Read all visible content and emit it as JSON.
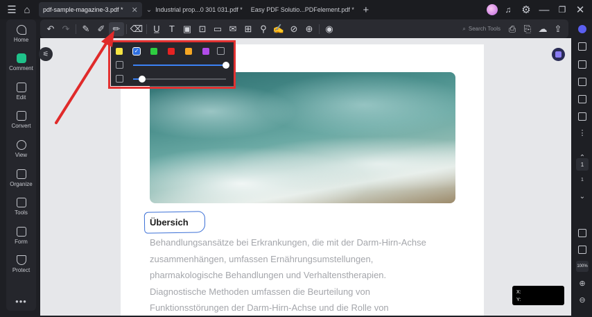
{
  "titlebar": {
    "tabs": [
      {
        "label": "pdf-sample-magazine-3.pdf *",
        "active": true
      },
      {
        "label": "Industrial  prop...0 301 031.pdf *",
        "active": false
      },
      {
        "label": "Easy PDF Solutio...PDFelement.pdf *",
        "active": false
      }
    ],
    "new_tab": "+",
    "close": "✕"
  },
  "sidebar": {
    "items": [
      {
        "label": "Home",
        "icon": "rocket-icon"
      },
      {
        "label": "Comment",
        "icon": "comment-icon",
        "active": true
      },
      {
        "label": "Edit",
        "icon": "edit-icon"
      },
      {
        "label": "Convert",
        "icon": "convert-icon"
      },
      {
        "label": "View",
        "icon": "view-icon"
      },
      {
        "label": "Organize",
        "icon": "organize-icon"
      },
      {
        "label": "Tools",
        "icon": "tools-icon"
      },
      {
        "label": "Form",
        "icon": "form-icon"
      },
      {
        "label": "Protect",
        "icon": "protect-icon"
      }
    ],
    "more": "•••"
  },
  "toolbar": {
    "search_placeholder": "Search Tools"
  },
  "popup": {
    "colors": [
      "#f5e342",
      "#2f6fe0",
      "#2ecc40",
      "#e52222",
      "#f5a623",
      "#b04be8"
    ],
    "selected_index": 1,
    "opacity_percent": 100,
    "thickness_percent": 10
  },
  "document": {
    "heading": "Übersich",
    "lines": [
      "Behandlungsansätze bei Erkrankungen, die mit der Darm-Hirn-Achse",
      "zusammenhängen, umfassen Ernährungsumstellungen,",
      "pharmakologische Behandlungen und Verhaltenstherapien.",
      "Diagnostische Methoden umfassen die Beurteilung von",
      "Funktionsstörungen der Darm-Hirn-Achse und die Rolle von"
    ]
  },
  "rightbar": {
    "page_current": "1",
    "page_total": "1",
    "zoom": "100%"
  },
  "coords": {
    "x_label": "X:",
    "y_label": "Y:"
  }
}
